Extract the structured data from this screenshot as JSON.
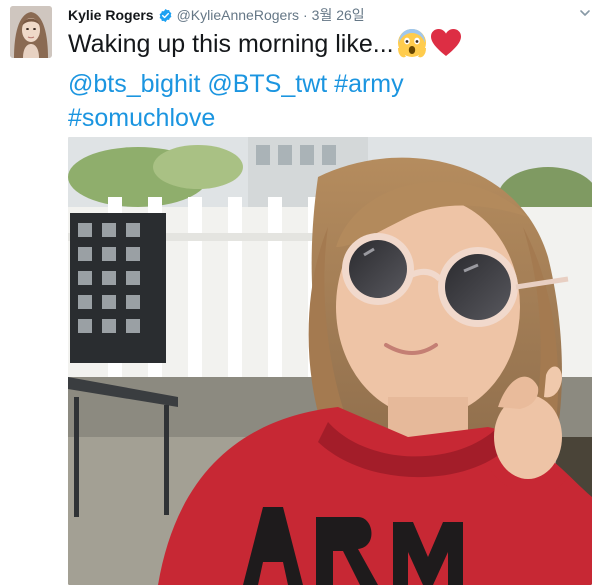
{
  "tweet": {
    "author": {
      "display_name": "Kylie Rogers",
      "handle": "@KylieAnneRogers",
      "verified_icon": "verified-badge-icon"
    },
    "timestamp": "3월 26일",
    "separator": "·",
    "text": {
      "line1": "Waking up this morning like...",
      "line2_parts": [
        "@bts_bighit",
        "@BTS_twt",
        "#army"
      ],
      "line3_parts": [
        "#somuchlove"
      ]
    },
    "emojis": [
      "face-screaming-in-fear-icon",
      "red-heart-icon"
    ],
    "media": {
      "type": "video-still",
      "caption_icon": "video-frame"
    }
  },
  "colors": {
    "link": "#1b95e0",
    "text": "#14171a",
    "muted": "#657786",
    "verified": "#1da1f2",
    "heart": "#e0245e"
  }
}
